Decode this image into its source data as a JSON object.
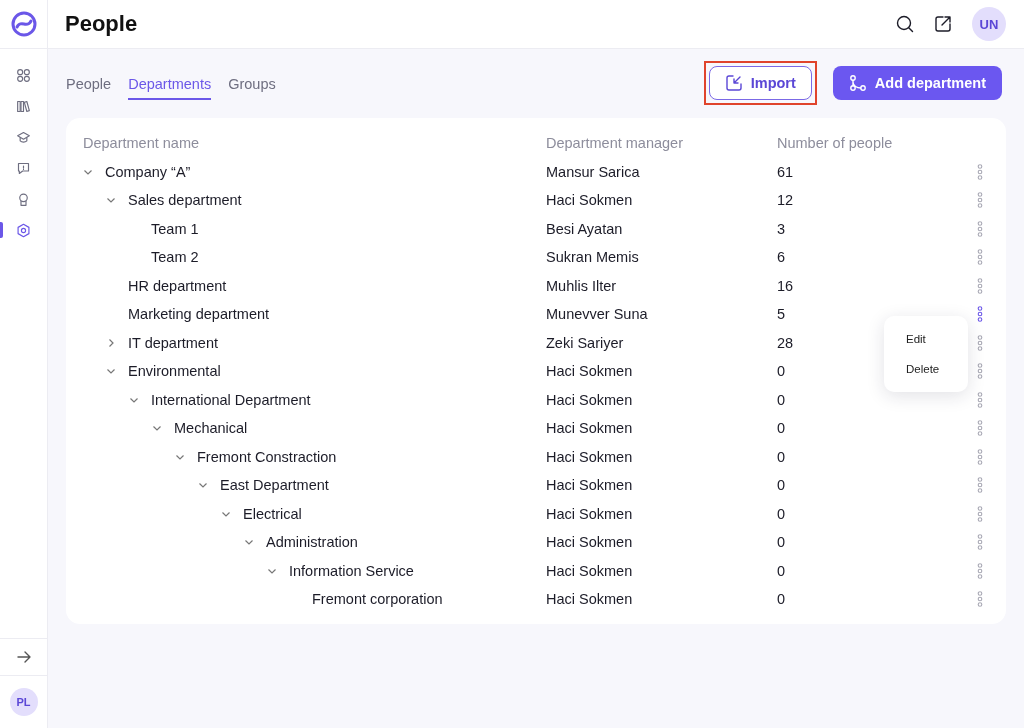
{
  "sidebar": {
    "nav": [
      {
        "selected": false
      },
      {
        "selected": false
      },
      {
        "selected": false
      },
      {
        "selected": false
      },
      {
        "selected": false
      },
      {
        "selected": true
      }
    ],
    "user_initials": "PL"
  },
  "header": {
    "title": "People",
    "user_initials": "UN"
  },
  "tabs": [
    {
      "label": "People",
      "selected": false
    },
    {
      "label": "Departments",
      "selected": true
    },
    {
      "label": "Groups",
      "selected": false
    }
  ],
  "actions": [
    {
      "kind": "outline",
      "label": "Import",
      "highlighted": true
    },
    {
      "kind": "primary",
      "label": "Add department",
      "highlighted": false
    }
  ],
  "table": {
    "columns": [
      "Department name",
      "Department manager",
      "Number of people"
    ],
    "rows": [
      {
        "name": "Company “A”",
        "manager": "Mansur Sarica",
        "count": "61",
        "selected": false,
        "expanded": true,
        "children": [
          {
            "name": "Sales department",
            "manager": "Haci Sokmen",
            "count": "12",
            "selected": false,
            "expanded": true,
            "children": [
              {
                "name": "Team 1",
                "manager": "Besi Ayatan",
                "count": "3",
                "selected": false
              },
              {
                "name": "Team 2",
                "manager": "Sukran Memis",
                "count": "6",
                "selected": false
              }
            ]
          },
          {
            "name": "HR department",
            "manager": "Muhlis Ilter",
            "count": "16",
            "selected": false
          },
          {
            "name": "Marketing department",
            "manager": "Munevver Suna",
            "count": "5",
            "selected": true
          },
          {
            "name": "IT department",
            "manager": "Zeki Sariyer",
            "count": "28",
            "selected": false,
            "expanded": false
          },
          {
            "name": "Environmental",
            "manager": "Haci Sokmen",
            "count": "0",
            "selected": false,
            "expanded": true,
            "children": [
              {
                "name": "International Department",
                "manager": "Haci Sokmen",
                "count": "0",
                "selected": false,
                "expanded": true,
                "children": [
                  {
                    "name": "Mechanical",
                    "manager": "Haci Sokmen",
                    "count": "0",
                    "selected": false,
                    "expanded": true,
                    "children": [
                      {
                        "name": "Fremont Constraction",
                        "manager": "Haci Sokmen",
                        "count": "0",
                        "selected": false,
                        "expanded": true,
                        "children": [
                          {
                            "name": "East Department",
                            "manager": "Haci Sokmen",
                            "count": "0",
                            "selected": false,
                            "expanded": true,
                            "children": [
                              {
                                "name": "Electrical",
                                "manager": "Haci Sokmen",
                                "count": "0",
                                "selected": false,
                                "expanded": true,
                                "children": [
                                  {
                                    "name": "Administration",
                                    "manager": "Haci Sokmen",
                                    "count": "0",
                                    "selected": false,
                                    "expanded": true,
                                    "children": [
                                      {
                                        "name": "Information Service",
                                        "manager": "Haci Sokmen",
                                        "count": "0",
                                        "selected": false,
                                        "expanded": true,
                                        "children": [
                                          {
                                            "name": "Fremont corporation",
                                            "manager": "Haci Sokmen",
                                            "count": "0",
                                            "selected": false
                                          }
                                        ]
                                      }
                                    ]
                                  }
                                ]
                              }
                            ]
                          }
                        ]
                      }
                    ]
                  }
                ]
              }
            ]
          }
        ]
      }
    ],
    "row_menu": [
      "Edit",
      "Delete"
    ]
  }
}
